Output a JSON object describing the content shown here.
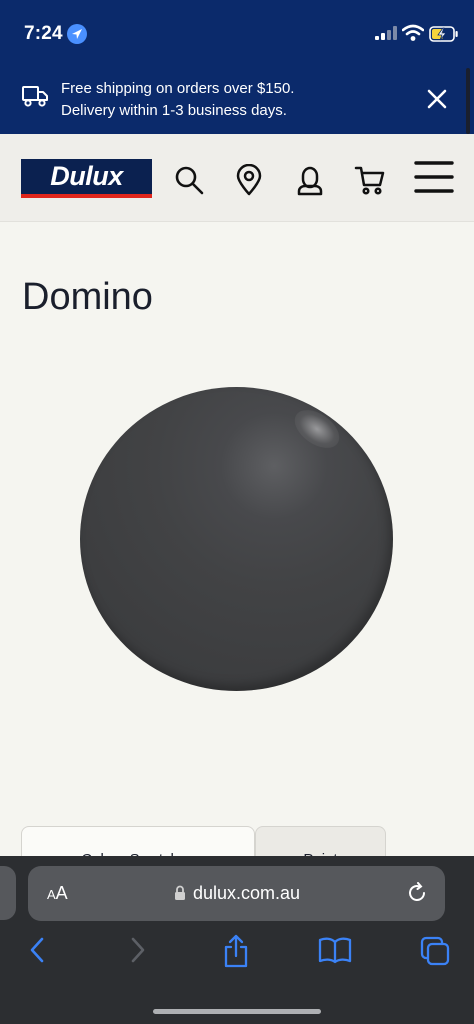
{
  "status_bar": {
    "time": "7:24"
  },
  "promo": {
    "line1": "Free shipping on orders over $150.",
    "line2": "Delivery within 1-3 business days."
  },
  "header": {
    "logo_text": "Dulux"
  },
  "product": {
    "title": "Domino",
    "swatch_color": "#424345"
  },
  "tabs": [
    {
      "label": "Colour Swatches"
    },
    {
      "label": "Paint"
    }
  ],
  "browser": {
    "aa_label_small": "A",
    "aa_label_large": "A",
    "url": "dulux.com.au"
  },
  "colors": {
    "brand_navy": "#0b2a6b",
    "logo_red": "#e1261c",
    "safari_blue": "#3b82f6"
  }
}
